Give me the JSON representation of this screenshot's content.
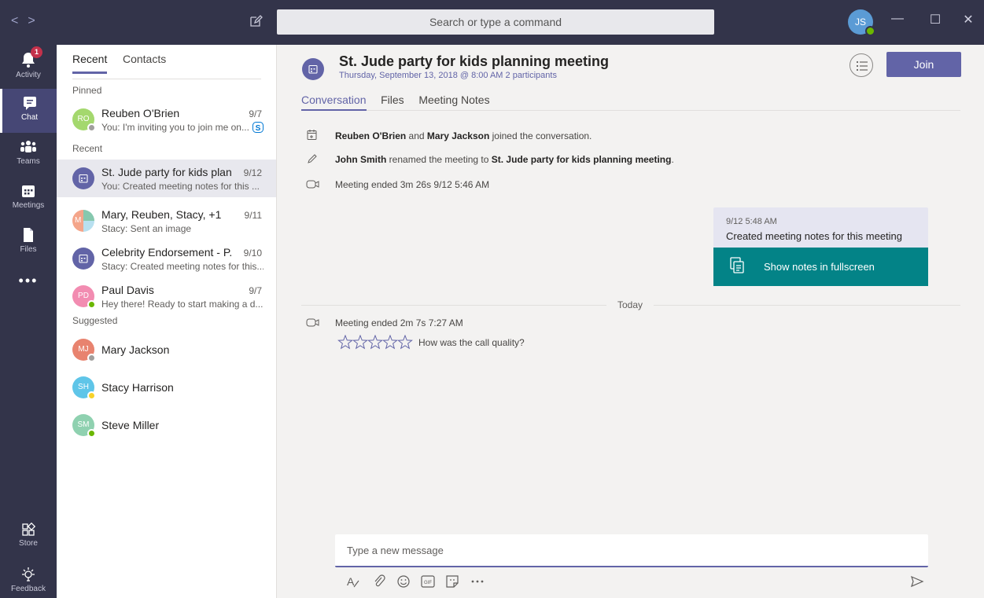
{
  "topbar": {
    "back": "<",
    "forward": ">",
    "search_placeholder": "Search or type a command",
    "user_initials": "JS",
    "win_min": "—",
    "win_max": "☐",
    "win_close": "✕"
  },
  "rail": {
    "activity": "Activity",
    "activity_badge": "1",
    "chat": "Chat",
    "teams": "Teams",
    "meetings": "Meetings",
    "files": "Files",
    "more": "•••",
    "store": "Store",
    "feedback": "Feedback"
  },
  "chatlist": {
    "tab_recent": "Recent",
    "tab_contacts": "Contacts",
    "pinned_label": "Pinned",
    "recent_label": "Recent",
    "suggested_label": "Suggested",
    "pinned": [
      {
        "initials": "RO",
        "name": "Reuben O'Brien",
        "date": "9/7",
        "preview": "You: I'm inviting you to join me on..."
      }
    ],
    "recent": [
      {
        "name": "St. Jude party for kids plan...",
        "date": "9/12",
        "preview": "You: Created meeting notes for this ..."
      },
      {
        "initials": "M",
        "name": "Mary, Reuben, Stacy, +1",
        "date": "9/11",
        "preview": "Stacy: Sent an image"
      },
      {
        "name": "Celebrity Endorsement - P...",
        "date": "9/10",
        "preview": "Stacy: Created meeting notes for this..."
      },
      {
        "initials": "PD",
        "name": "Paul Davis",
        "date": "9/7",
        "preview": "Hey there! Ready to start making a d..."
      }
    ],
    "suggested": [
      {
        "initials": "MJ",
        "name": "Mary Jackson"
      },
      {
        "initials": "SH",
        "name": "Stacy Harrison"
      },
      {
        "initials": "SM",
        "name": "Steve Miller"
      }
    ]
  },
  "meeting": {
    "title": "St. Jude party for kids planning meeting",
    "subtitle": "Thursday, September 13, 2018 @ 8:00 AM 2 participants",
    "join_label": "Join",
    "tabs": [
      "Conversation",
      "Files",
      "Meeting Notes"
    ]
  },
  "events": {
    "joined_name1": "Reuben O'Brien",
    "joined_and": " and ",
    "joined_name2": "Mary Jackson",
    "joined_rest": " joined the conversation.",
    "renamed_name": "John Smith",
    "renamed_mid": " renamed the meeting to ",
    "renamed_title": "St. Jude party for kids planning meeting",
    "renamed_end": ".",
    "ended1": "Meeting ended  3m 26s   9/12 5:46 AM",
    "ended2": "Meeting ended  2m 7s   7:27 AM"
  },
  "bubble": {
    "time": "9/12 5:48 AM",
    "message": "Created meeting notes for this meeting",
    "button": "Show notes in fullscreen"
  },
  "divider_label": "Today",
  "rating": {
    "question": "How was the call quality?",
    "stars": 0,
    "max": 5
  },
  "composer": {
    "placeholder": "Type a new message"
  },
  "colors": {
    "brand": "#6264a7",
    "rail": "#33344a",
    "teal": "#038387",
    "available": "#6bb700",
    "away": "#f8d22a",
    "offline": "#a19f9d"
  }
}
